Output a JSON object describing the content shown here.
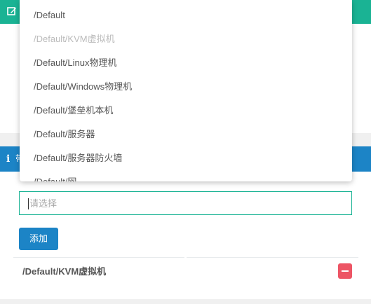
{
  "colors": {
    "green_header": "#1ab394",
    "blue_header": "#1c84c6",
    "danger": "#ed5565"
  },
  "dropdown": {
    "options": [
      {
        "label": "/Default",
        "disabled": false
      },
      {
        "label": "/Default/KVM虚拟机",
        "disabled": true
      },
      {
        "label": "/Default/Linux物理机",
        "disabled": false
      },
      {
        "label": "/Default/Windows物理机",
        "disabled": false
      },
      {
        "label": "/Default/堡垒机本机",
        "disabled": false
      },
      {
        "label": "/Default/服务器",
        "disabled": false
      },
      {
        "label": "/Default/服务器防火墙",
        "disabled": false
      },
      {
        "label": "/Default/网",
        "disabled": false
      }
    ]
  },
  "form": {
    "placeholder": "请选择",
    "add_label": "添加"
  },
  "selected_rows": [
    {
      "label": "/Default/KVM虚拟机"
    }
  ],
  "icons": {
    "header_top": "edit-icon",
    "header_bottom": "info-icon",
    "remove": "minus-icon"
  }
}
